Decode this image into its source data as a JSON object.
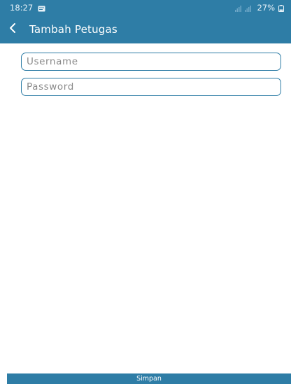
{
  "status_bar": {
    "time": "18:27",
    "battery_percent": "27%",
    "icons": [
      "message-icon",
      "signal-icon",
      "battery-icon"
    ]
  },
  "app_bar": {
    "title": "Tambah Petugas",
    "back_icon": "chevron-left-icon"
  },
  "form": {
    "username": {
      "placeholder": "Username",
      "value": ""
    },
    "password": {
      "placeholder": "Password",
      "value": ""
    }
  },
  "save_button": {
    "label": "Simpan"
  },
  "colors": {
    "primary": "#2e7da6",
    "background": "#ffffff",
    "placeholder": "#8a8a8a"
  }
}
